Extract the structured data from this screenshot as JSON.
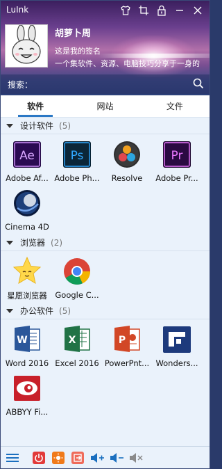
{
  "window": {
    "title": "LuInk",
    "icons": [
      "shirt-icon",
      "crop-icon",
      "lock-icon",
      "minimize-icon",
      "close-icon"
    ]
  },
  "profile": {
    "nickname": "胡萝卜周",
    "signature_line1": "这是我的签名",
    "signature_line2": "一个集软件、资源、电脑技巧分享于一身的"
  },
  "search": {
    "label": "搜索：",
    "placeholder": ""
  },
  "tabs": [
    {
      "label": "软件",
      "active": true
    },
    {
      "label": "网站",
      "active": false
    },
    {
      "label": "文件",
      "active": false
    }
  ],
  "groups": [
    {
      "name": "设计软件",
      "count": "(5)",
      "apps": [
        {
          "label": "Adobe Af...",
          "icon": "after-effects-icon"
        },
        {
          "label": "Adobe Ph...",
          "icon": "photoshop-icon"
        },
        {
          "label": "Resolve",
          "icon": "davinci-resolve-icon"
        },
        {
          "label": "Adobe Pr...",
          "icon": "premiere-icon"
        },
        {
          "label": "Cinema 4D",
          "icon": "cinema4d-icon"
        }
      ]
    },
    {
      "name": "浏览器",
      "count": "(2)",
      "apps": [
        {
          "label": "星愿浏览器",
          "icon": "star-browser-icon"
        },
        {
          "label": "Google C...",
          "icon": "chrome-icon"
        }
      ]
    },
    {
      "name": "办公软件",
      "count": "(5)",
      "apps": [
        {
          "label": "Word 2016",
          "icon": "word-icon"
        },
        {
          "label": "Excel 2016",
          "icon": "excel-icon"
        },
        {
          "label": "PowerPnt...",
          "icon": "powerpoint-icon"
        },
        {
          "label": "Wonders...",
          "icon": "wondershare-icon"
        },
        {
          "label": "ABBYY Fi...",
          "icon": "abbyy-icon"
        }
      ]
    }
  ],
  "toolbar": [
    "menu-icon",
    "power-icon",
    "sun-icon",
    "exit-icon",
    "volume-up-icon",
    "volume-down-icon",
    "mute-icon"
  ],
  "colors": {
    "accent": "#2b78c5",
    "content_bg": "#eaf2fb"
  }
}
